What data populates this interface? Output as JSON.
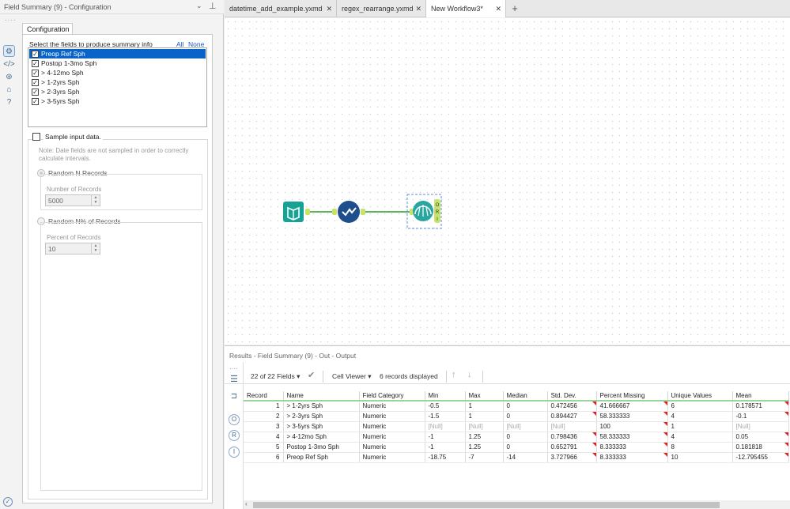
{
  "panel": {
    "title": "Field Summary (9) - Configuration",
    "tab_label": "Configuration",
    "select_label": "Select the fields to produce summary info",
    "all_link": "All",
    "none_link": "None",
    "fields": [
      {
        "label": "Preop Ref Sph",
        "checked": true,
        "selected": true
      },
      {
        "label": "Postop 1-3mo Sph",
        "checked": true,
        "selected": false
      },
      {
        "label": "> 4-12mo Sph",
        "checked": true,
        "selected": false
      },
      {
        "label": "> 1-2yrs Sph",
        "checked": true,
        "selected": false
      },
      {
        "label": "> 2-3yrs Sph",
        "checked": true,
        "selected": false
      },
      {
        "label": "> 3-5yrs Sph",
        "checked": true,
        "selected": false
      }
    ],
    "sample_label": "Sample input data.",
    "sample_note": "Note: Date fields are not sampled in order to correctly calculate intervals.",
    "random_n_label": "Random N Records",
    "num_records_label": "Number of Records",
    "num_records_value": "5000",
    "random_pct_label": "Random N% of Records",
    "pct_records_label": "Percent of Records",
    "pct_records_value": "10"
  },
  "tabs": [
    {
      "label": "datetime_add_example.yxmd",
      "active": false
    },
    {
      "label": "regex_rearrange.yxmd",
      "active": false
    },
    {
      "label": "New Workflow3*",
      "active": true
    }
  ],
  "results": {
    "title": "Results - Field Summary (9) - Out - Output",
    "fields_count": "22 of 22 Fields",
    "cell_viewer": "Cell Viewer",
    "records_displayed": "6 records displayed",
    "columns": [
      "Record",
      "Name",
      "Field Category",
      "Min",
      "Max",
      "Median",
      "Std. Dev.",
      "Percent Missing",
      "Unique Values",
      "Mean"
    ],
    "rows": [
      [
        "1",
        "> 1-2yrs Sph",
        "Numeric",
        "-0.5",
        "1",
        "0",
        "0.472456",
        "41.666667",
        "6",
        "0.178571"
      ],
      [
        "2",
        "> 2-3yrs Sph",
        "Numeric",
        "-1.5",
        "1",
        "0",
        "0.894427",
        "58.333333",
        "4",
        "-0.1"
      ],
      [
        "3",
        "> 3-5yrs Sph",
        "Numeric",
        "[Null]",
        "[Null]",
        "[Null]",
        "[Null]",
        "100",
        "1",
        "[Null]"
      ],
      [
        "4",
        "> 4-12mo Sph",
        "Numeric",
        "-1",
        "1.25",
        "0",
        "0.798436",
        "58.333333",
        "4",
        "0.05"
      ],
      [
        "5",
        "Postop 1-3mo Sph",
        "Numeric",
        "-1",
        "1.25",
        "0",
        "0.652791",
        "8.333333",
        "8",
        "0.181818"
      ],
      [
        "6",
        "Preop Ref Sph",
        "Numeric",
        "-18.75",
        "-7",
        "-14",
        "3.727966",
        "8.333333",
        "10",
        "-12.795455"
      ]
    ]
  },
  "colors": {
    "input_tool": "#16a396",
    "select_tool": "#1f4e8c",
    "summary_tool": "#2aa6a0",
    "connector": "#57b95a",
    "selection_blue": "#0a63c9"
  }
}
